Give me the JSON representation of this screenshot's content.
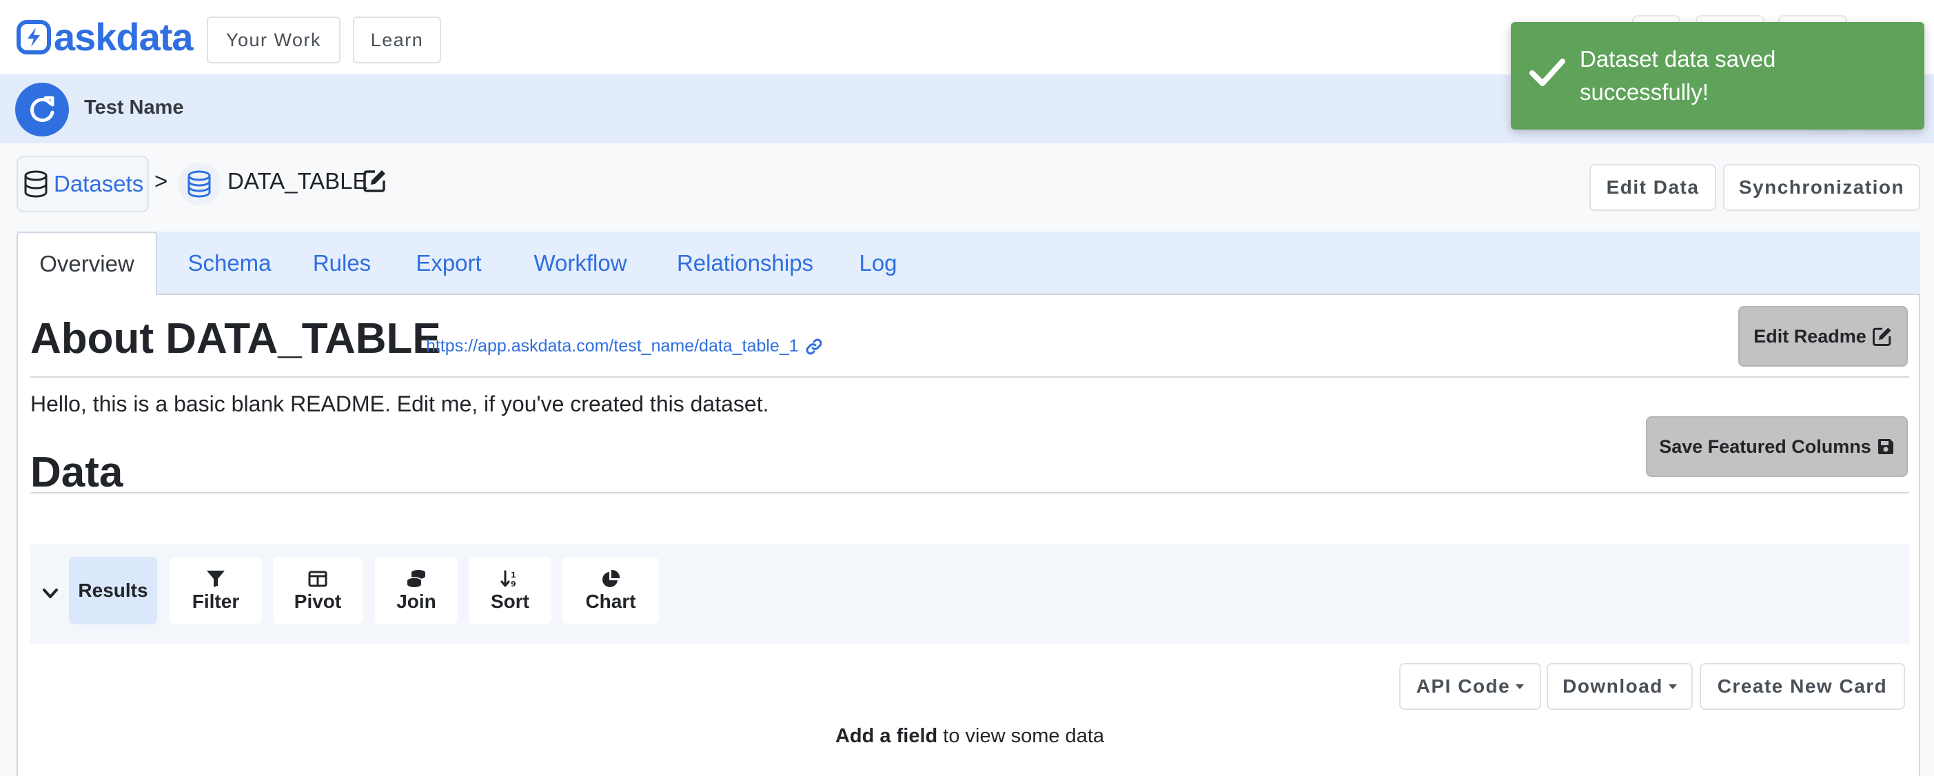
{
  "app": {
    "logo_text": "askdata",
    "brand_color": "#2f6fe0"
  },
  "nav": {
    "your_work": "Your Work",
    "learn": "Learn"
  },
  "user": {
    "name": "Test Name"
  },
  "toast": {
    "message": "Dataset data saved successfully!",
    "color": "#5fa25a"
  },
  "breadcrumb": {
    "datasets": "Datasets",
    "separator": ">",
    "table": "DATA_TABLE"
  },
  "header_actions": {
    "edit_data": "Edit Data",
    "synchronization": "Synchronization"
  },
  "tabs": [
    {
      "label": "Overview",
      "active": true
    },
    {
      "label": "Schema"
    },
    {
      "label": "Rules"
    },
    {
      "label": "Export"
    },
    {
      "label": "Workflow"
    },
    {
      "label": "Relationships"
    },
    {
      "label": "Log"
    }
  ],
  "about": {
    "title": "About DATA_TABLE",
    "link": "https://app.askdata.com/test_name/data_table_1",
    "edit_readme": "Edit Readme",
    "readme_text": "Hello, this is a basic blank README. Edit me, if you've created this dataset."
  },
  "data_section": {
    "title": "Data",
    "save_featured": "Save Featured Columns"
  },
  "toolbar": {
    "results": "Results",
    "filter": "Filter",
    "pivot": "Pivot",
    "join": "Join",
    "sort": "Sort",
    "chart": "Chart"
  },
  "output_actions": {
    "api_code": "API Code",
    "download": "Download",
    "create_card": "Create New Card"
  },
  "empty_state": {
    "bold": "Add a field",
    "rest": " to view some data"
  }
}
